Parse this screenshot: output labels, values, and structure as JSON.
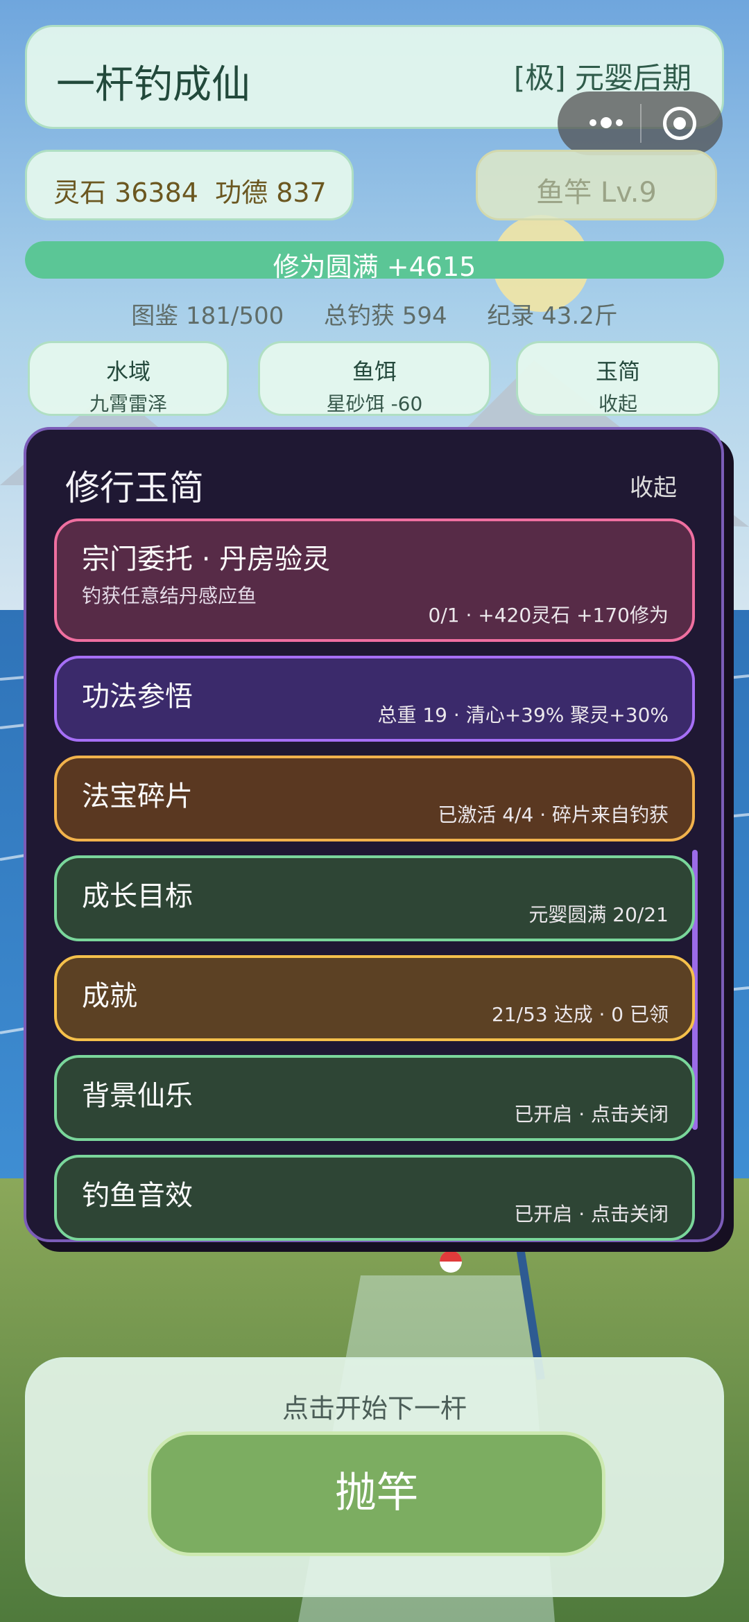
{
  "app": {
    "title": "一杆钓成仙",
    "rank": "[极] 元婴后期"
  },
  "resources": {
    "text": "灵石 36384  功德 837"
  },
  "rod": {
    "label": "鱼竿 Lv.9"
  },
  "cultivation": {
    "label": "修为圆满 +4615",
    "progress_fraction": 1.0
  },
  "stats": {
    "catalog": "图鉴 181/500",
    "total": "总钓获 594",
    "record": "纪录 43.2斤"
  },
  "tabs": [
    {
      "title": "水域",
      "sub": "九霄雷泽"
    },
    {
      "title": "鱼饵",
      "sub": "星砂饵 -60"
    },
    {
      "title": "玉简",
      "sub": "收起"
    }
  ],
  "panel": {
    "title": "修行玉简",
    "collapse_label": "收起",
    "items": [
      {
        "name": "宗门委托 · 丹房验灵",
        "sub": "钓获任意结丹感应鱼",
        "detail": "0/1 · +420灵石 +170修为",
        "border": "#ef6fa0",
        "bg": "#572b47"
      },
      {
        "name": "功法参悟",
        "sub": "",
        "detail": "总重 19 · 清心+39% 聚灵+30%",
        "border": "#a66ff6",
        "bg": "#3b2a6b"
      },
      {
        "name": "法宝碎片",
        "sub": "",
        "detail": "已激活 4/4 · 碎片来自钓获",
        "border": "#f1b24c",
        "bg": "#5a3821"
      },
      {
        "name": "成长目标",
        "sub": "",
        "detail": "元婴圆满 20/21",
        "border": "#7ad69b",
        "bg": "#2e4535"
      },
      {
        "name": "成就",
        "sub": "",
        "detail": "21/53 达成 · 0 已领",
        "border": "#f5c04b",
        "bg": "#5c4124"
      },
      {
        "name": "背景仙乐",
        "sub": "",
        "detail": "已开启 · 点击关闭",
        "border": "#7ad69b",
        "bg": "#2e4535"
      },
      {
        "name": "钓鱼音效",
        "sub": "",
        "detail": "已开启 · 点击关闭",
        "border": "#7ad69b",
        "bg": "#2e4535"
      }
    ]
  },
  "bottom": {
    "prompt": "点击开始下一杆",
    "cast_label": "抛竿"
  },
  "colors": {
    "accent_green": "#5bc696",
    "panel_bg": "#1f1833",
    "panel_border": "#7b5cb8"
  },
  "icons": {
    "more": "more-dots-icon",
    "close": "target-circle-icon"
  }
}
